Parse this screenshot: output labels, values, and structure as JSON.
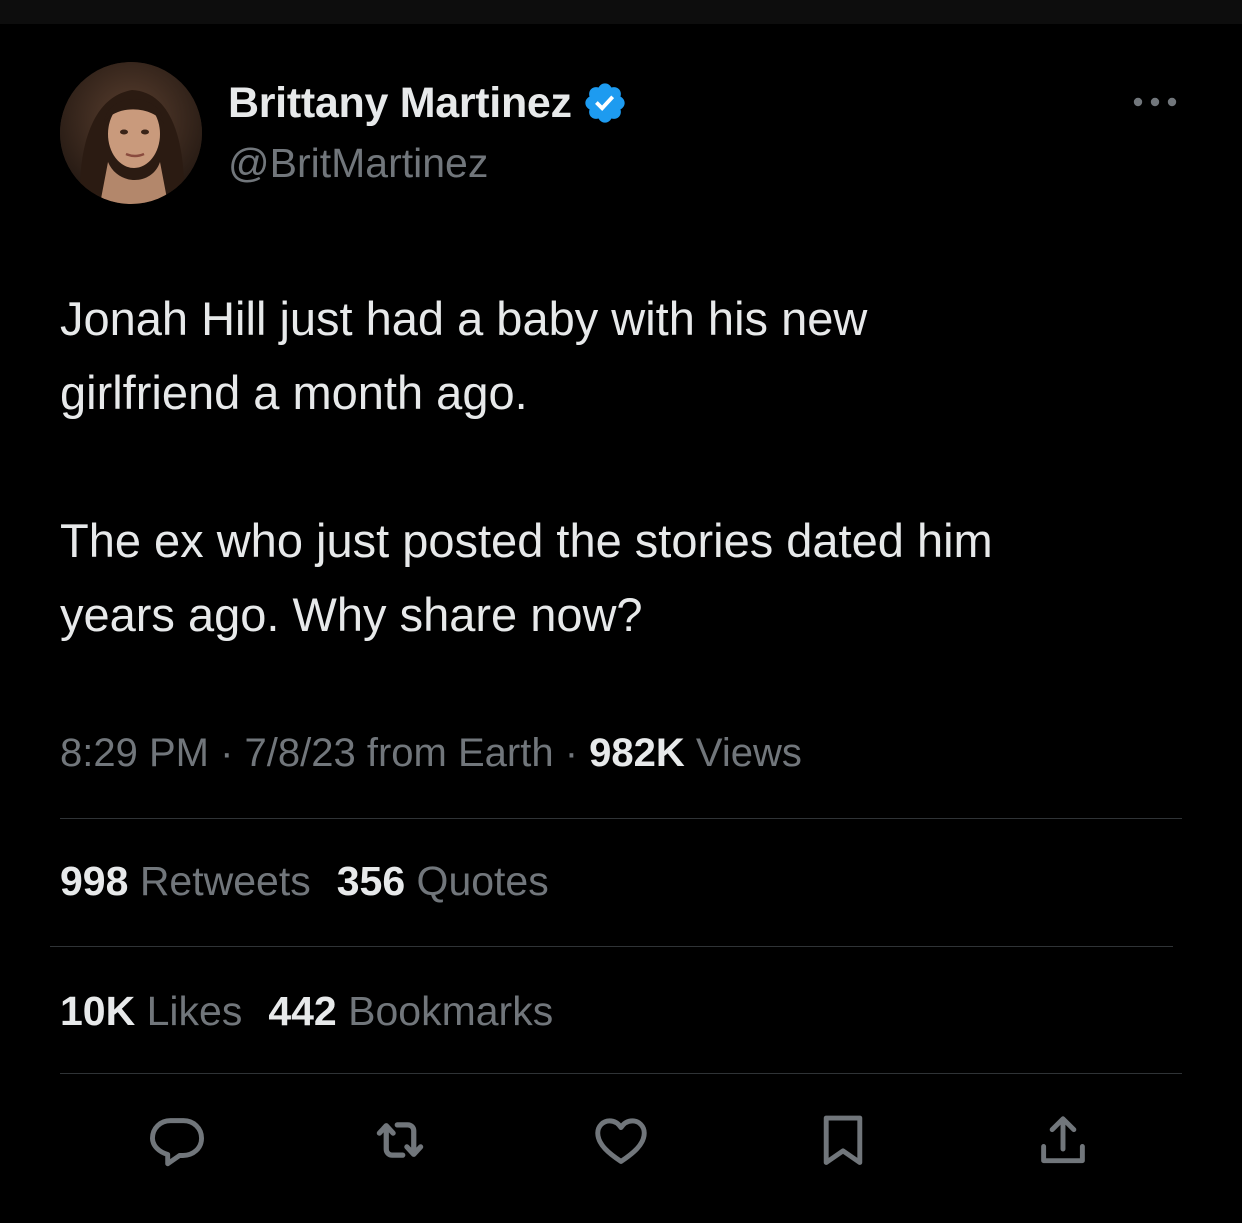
{
  "author": {
    "display_name": "Brittany Martinez",
    "handle": "@BritMartinez",
    "verified_icon": "verified-badge-icon",
    "verified_color": "#1d9bf0"
  },
  "tweet": {
    "paragraphs": [
      "Jonah Hill just had a baby with his new\ngirlfriend a month ago.",
      "The ex who just posted the stories dated him\nyears ago. Why share now?"
    ]
  },
  "meta": {
    "time": "8:29 PM",
    "sep1": " · ",
    "date": "7/8/23",
    "source": " from Earth",
    "sep2": " · ",
    "views_count": "982K",
    "views_label": " Views"
  },
  "stats": {
    "retweets_count": "998",
    "retweets_label": " Retweets",
    "quotes_count": "356",
    "quotes_label": " Quotes",
    "likes_count": "10K",
    "likes_label": " Likes",
    "bookmarks_count": "442",
    "bookmarks_label": " Bookmarks"
  },
  "actions": [
    "reply-icon",
    "retweet-icon",
    "like-icon",
    "bookmark-icon",
    "share-icon"
  ],
  "colors": {
    "background": "#000000",
    "text_primary": "#e7e9ea",
    "text_secondary": "#71767b",
    "divider": "#2f3336"
  }
}
